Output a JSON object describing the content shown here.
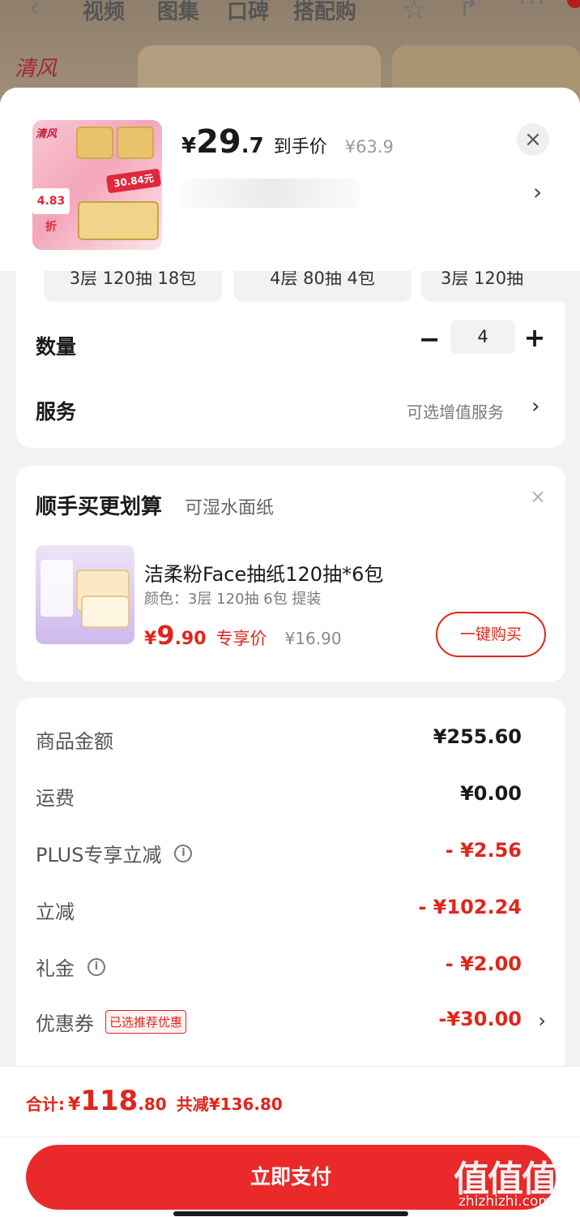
{
  "background": {
    "nav_tabs": [
      "视频",
      "图集",
      "口碑",
      "搭配购"
    ],
    "back_icon": "chevron-left-icon",
    "brand": "清风"
  },
  "header": {
    "price_symbol": "¥",
    "price_int": "29",
    "price_dec": ".7",
    "price_tag": "到手价",
    "original_price": "¥63.9",
    "close_icon": "close-icon",
    "thumb_labels": {
      "logo": "清风",
      "badge": "30.84元",
      "discount": "4.83折"
    }
  },
  "spec": {
    "chips": [
      "3层 120抽 18包",
      "4层 80抽 4包",
      "3层 120抽"
    ],
    "quantity_label": "数量",
    "quantity_value": "4",
    "minus": "−",
    "plus": "+",
    "service_label": "服务",
    "service_value": "可选增值服务"
  },
  "bundle": {
    "title": "顺手买更划算",
    "subtitle": "可湿水面纸",
    "close": "×",
    "product_name": "洁柔粉Face抽纸120抽*6包",
    "attr": "颜色：3层 120抽 6包 提装",
    "price_symbol": "¥",
    "price_int": "9",
    "price_dec": ".90",
    "price_label": "专享价",
    "original_price": "¥16.90",
    "buy_button": "一键购买"
  },
  "summary": {
    "rows": [
      {
        "label": "商品金额",
        "value": "¥255.60",
        "red": false
      },
      {
        "label": "运费",
        "value": "¥0.00",
        "red": false
      },
      {
        "label": "PLUS专享立减",
        "value": "- ¥2.56",
        "red": true
      },
      {
        "label": "立减",
        "value": "- ¥102.24",
        "red": true
      },
      {
        "label": "礼金",
        "value": "- ¥2.00",
        "red": true
      },
      {
        "label": "优惠券",
        "value": "-¥30.00",
        "red": true
      }
    ],
    "coupon_tag": "已选推荐优惠",
    "info_glyph": "i"
  },
  "footer": {
    "total_label": "合计:",
    "total_symbol": "¥",
    "total_int": "118",
    "total_dec": ".80",
    "reduction": "共减¥136.80",
    "pay_button": "立即支付",
    "watermark": "值值值",
    "watermark_url": "zhizhizhi.com"
  },
  "colors": {
    "accent": "#e1251b",
    "pay_button": "#ea2a2a"
  }
}
